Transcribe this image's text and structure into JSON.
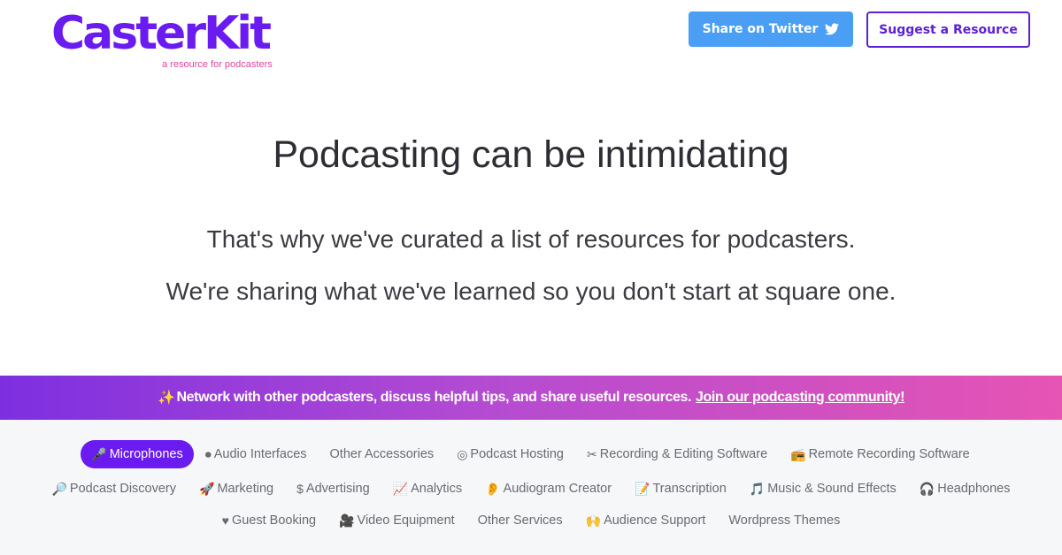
{
  "header": {
    "logo": "CasterKit",
    "tagline": "a resource for podcasters",
    "twitter_button": "Share on Twitter",
    "suggest_button": "Suggest a Resource"
  },
  "hero": {
    "title": "Podcasting can be intimidating",
    "line1": "That's why we've curated a list of resources for podcasters.",
    "line2": "We're sharing what we've learned so you don't start at square one."
  },
  "banner": {
    "text": "Network with other podcasters, discuss helpful tips, and share useful resources.",
    "link": "Join our podcasting community!"
  },
  "categories": {
    "row1": [
      {
        "label": "Microphones",
        "icon": "microphone-icon",
        "glyph": "🎤",
        "active": true
      },
      {
        "label": "Audio Interfaces",
        "icon": "audio-interface-icon",
        "glyph": "⏺",
        "active": false
      },
      {
        "label": "Other Accessories",
        "icon": "",
        "glyph": "",
        "active": false
      },
      {
        "label": "Podcast Hosting",
        "icon": "hosting-icon",
        "glyph": "◎",
        "active": false
      },
      {
        "label": "Recording & Editing Software",
        "icon": "scissors-icon",
        "glyph": "✂",
        "active": false
      },
      {
        "label": "Remote Recording Software",
        "icon": "radio-icon",
        "glyph": "📻",
        "active": false
      }
    ],
    "row2": [
      {
        "label": "Podcast Discovery",
        "icon": "magnifier-icon",
        "glyph": "🔎",
        "active": false
      },
      {
        "label": "Marketing",
        "icon": "rocket-icon",
        "glyph": "🚀",
        "active": false
      },
      {
        "label": "Advertising",
        "icon": "dollar-icon",
        "glyph": "$",
        "active": false
      },
      {
        "label": "Analytics",
        "icon": "chart-icon",
        "glyph": "📈",
        "active": false
      },
      {
        "label": "Audiogram Creator",
        "icon": "ear-icon",
        "glyph": "👂",
        "active": false
      },
      {
        "label": "Transcription",
        "icon": "memo-icon",
        "glyph": "📝",
        "active": false
      },
      {
        "label": "Music & Sound Effects",
        "icon": "music-icon",
        "glyph": "🎵",
        "active": false
      },
      {
        "label": "Headphones",
        "icon": "headphones-icon",
        "glyph": "🎧",
        "active": false
      }
    ],
    "row3": [
      {
        "label": "Guest Booking",
        "icon": "heart-icon",
        "glyph": "♥",
        "active": false
      },
      {
        "label": "Video Equipment",
        "icon": "video-camera-icon",
        "glyph": "🎥",
        "active": false
      },
      {
        "label": "Other Services",
        "icon": "",
        "glyph": "",
        "active": false
      },
      {
        "label": "Audience Support",
        "icon": "hands-icon",
        "glyph": "🙌",
        "active": false
      },
      {
        "label": "Wordpress Themes",
        "icon": "",
        "glyph": "",
        "active": false
      }
    ]
  },
  "colors": {
    "brand": "#6a1bf0",
    "accent_pink": "#e0439e",
    "twitter_blue": "#4a9ff5",
    "banner_start": "#7d2fe0",
    "banner_end": "#e654b4",
    "category_bg": "#f6f7f9"
  }
}
